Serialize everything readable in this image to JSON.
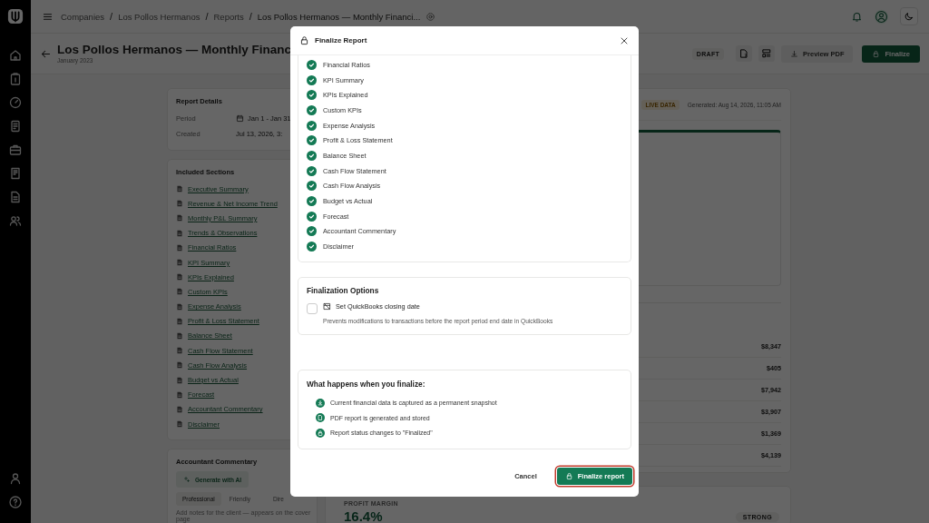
{
  "breadcrumbs": [
    "Companies",
    "Los Pollos Hermanos",
    "Reports",
    "Los Pollos Hermanos — Monthly Financi..."
  ],
  "breadcrumb_separator": "/",
  "page": {
    "title": "Los Pollos Hermanos — Monthly Financ",
    "subtitle": "January 2023",
    "status": "DRAFT",
    "buttons": [
      {
        "label": "Preview PDF",
        "kind": "secondary"
      },
      {
        "label": "Finalize",
        "kind": "primary"
      }
    ]
  },
  "report_details": {
    "title": "Report Details",
    "rows": [
      {
        "label": "Period",
        "value": "Jan 1 - Jan 31",
        "kind": "date"
      },
      {
        "label": "Created",
        "value": "Jul 13, 2026, 3:",
        "kind": "text"
      }
    ]
  },
  "included_sections": {
    "title": "Included Sections",
    "items": [
      "Executive Summary",
      "Revenue & Net Income Trend",
      "Monthly P&L Summary",
      "Trends & Observations",
      "Financial Ratios",
      "KPI Summary",
      "KPIs Explained",
      "Custom KPIs",
      "Expense Analysis",
      "Profit & Loss Statement",
      "Balance Sheet",
      "Cash Flow Statement",
      "Cash Flow Analysis",
      "Budget vs Actual",
      "Forecast",
      "Accountant Commentary",
      "Disclaimer"
    ]
  },
  "commentary": {
    "title": "Accountant Commentary",
    "generate_button": "Generate with AI",
    "tones": [
      {
        "label": "Professional",
        "selected": true
      },
      {
        "label": "Friendly",
        "selected": false
      },
      {
        "label": "Dire",
        "selected": false
      }
    ],
    "placeholder": "Add notes for the client — appears on the cover page"
  },
  "preview": {
    "badge": "LIVE DATA",
    "generated": "Generated: Aug 14, 2026, 11:05 AM",
    "amounts": [
      "$8,347",
      "$405",
      "$7,942",
      "$3,907",
      "$1,369",
      "$4,139"
    ],
    "metric": {
      "label": "PROFIT MARGIN",
      "value": "16.4%",
      "rating": "STRONG"
    }
  },
  "modal": {
    "title": "Finalize Report",
    "sections": [
      {
        "label": "Financial Ratios",
        "checked": true
      },
      {
        "label": "KPI Summary",
        "checked": true
      },
      {
        "label": "KPIs Explained",
        "checked": true
      },
      {
        "label": "Custom KPIs",
        "checked": true
      },
      {
        "label": "Expense Analysis",
        "checked": true
      },
      {
        "label": "Profit & Loss Statement",
        "checked": true
      },
      {
        "label": "Balance Sheet",
        "checked": true
      },
      {
        "label": "Cash Flow Statement",
        "checked": true
      },
      {
        "label": "Cash Flow Analysis",
        "checked": true
      },
      {
        "label": "Budget vs Actual",
        "checked": true
      },
      {
        "label": "Forecast",
        "checked": true
      },
      {
        "label": "Accountant Commentary",
        "checked": true
      },
      {
        "label": "Disclaimer",
        "checked": true
      }
    ],
    "options": {
      "title": "Finalization Options",
      "items": [
        {
          "label": "Set QuickBooks closing date",
          "description": "Prevents modifications to transactions before the report period end date in QuickBooks",
          "checked": false
        }
      ]
    },
    "info": {
      "title": "What happens when you finalize:",
      "items": [
        "Current financial data is captured as a permanent snapshot",
        "PDF report is generated and stored",
        "Report status changes to \"Finalized\""
      ]
    },
    "cancel": "Cancel",
    "confirm": "Finalize report"
  }
}
